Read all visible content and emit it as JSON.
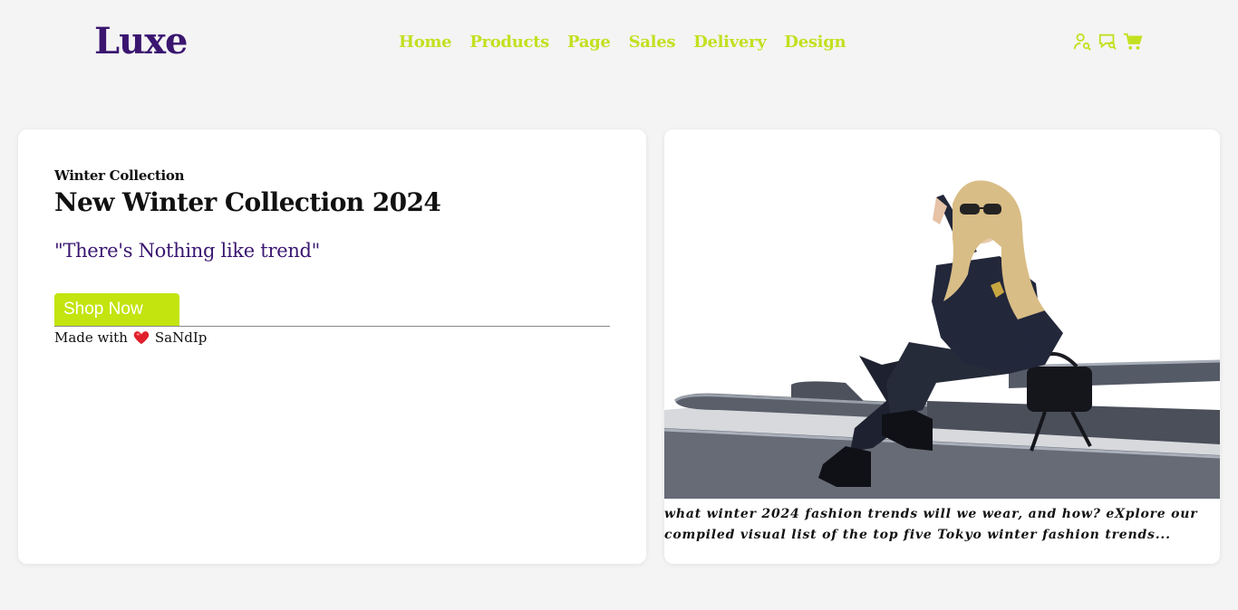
{
  "header": {
    "logo": "Luxe",
    "nav": [
      "Home",
      "Products",
      "Page",
      "Sales",
      "Delivery",
      "Design"
    ],
    "icons": [
      "user-search-icon",
      "chat-search-icon",
      "cart-icon"
    ]
  },
  "hero": {
    "eyebrow": "Winter Collection",
    "headline": "New Winter Collection 2024",
    "tagline": "\"There's Nothing like trend\"",
    "cta_label": "Shop Now",
    "credit_prefix": "Made with",
    "credit_author": "SaNdIp"
  },
  "feature": {
    "caption": "what winter 2024 fashion trends will we wear, and how? eXplore our compiled visual list of the top five Tokyo winter fashion trends..."
  },
  "colors": {
    "brand": "#3a1670",
    "accent": "#c3e020",
    "background": "#f4f4f4"
  }
}
